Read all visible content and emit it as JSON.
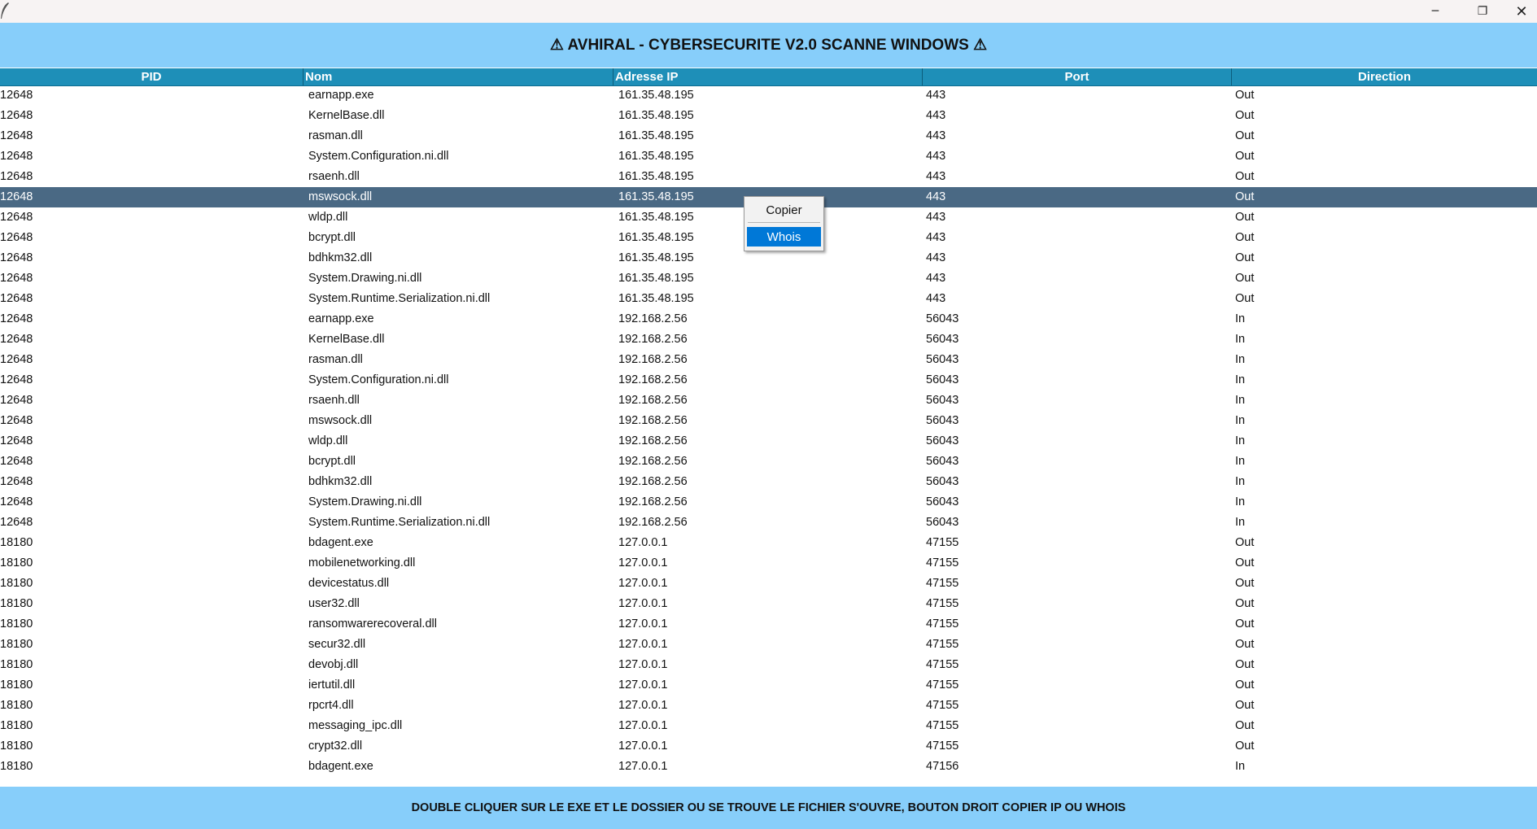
{
  "window": {
    "app_icon": "feather-icon",
    "controls": {
      "minimize": "─",
      "maximize": "❐",
      "close": "✕"
    }
  },
  "header": {
    "title": "⚠ AVHIRAL - CYBERSECURITE V2.0 SCANNE WINDOWS ⚠"
  },
  "table": {
    "columns": [
      "PID",
      "Nom",
      "Adresse IP",
      "Port",
      "Direction"
    ],
    "selected_row_index": 5,
    "rows": [
      [
        "12648",
        "earnapp.exe",
        "161.35.48.195",
        "443",
        "Out"
      ],
      [
        "12648",
        "KernelBase.dll",
        "161.35.48.195",
        "443",
        "Out"
      ],
      [
        "12648",
        "rasman.dll",
        "161.35.48.195",
        "443",
        "Out"
      ],
      [
        "12648",
        "System.Configuration.ni.dll",
        "161.35.48.195",
        "443",
        "Out"
      ],
      [
        "12648",
        "rsaenh.dll",
        "161.35.48.195",
        "443",
        "Out"
      ],
      [
        "12648",
        "mswsock.dll",
        "161.35.48.195",
        "443",
        "Out"
      ],
      [
        "12648",
        "wldp.dll",
        "161.35.48.195",
        "443",
        "Out"
      ],
      [
        "12648",
        "bcrypt.dll",
        "161.35.48.195",
        "443",
        "Out"
      ],
      [
        "12648",
        "bdhkm32.dll",
        "161.35.48.195",
        "443",
        "Out"
      ],
      [
        "12648",
        "System.Drawing.ni.dll",
        "161.35.48.195",
        "443",
        "Out"
      ],
      [
        "12648",
        "System.Runtime.Serialization.ni.dll",
        "161.35.48.195",
        "443",
        "Out"
      ],
      [
        "12648",
        "earnapp.exe",
        "192.168.2.56",
        "56043",
        "In"
      ],
      [
        "12648",
        "KernelBase.dll",
        "192.168.2.56",
        "56043",
        "In"
      ],
      [
        "12648",
        "rasman.dll",
        "192.168.2.56",
        "56043",
        "In"
      ],
      [
        "12648",
        "System.Configuration.ni.dll",
        "192.168.2.56",
        "56043",
        "In"
      ],
      [
        "12648",
        "rsaenh.dll",
        "192.168.2.56",
        "56043",
        "In"
      ],
      [
        "12648",
        "mswsock.dll",
        "192.168.2.56",
        "56043",
        "In"
      ],
      [
        "12648",
        "wldp.dll",
        "192.168.2.56",
        "56043",
        "In"
      ],
      [
        "12648",
        "bcrypt.dll",
        "192.168.2.56",
        "56043",
        "In"
      ],
      [
        "12648",
        "bdhkm32.dll",
        "192.168.2.56",
        "56043",
        "In"
      ],
      [
        "12648",
        "System.Drawing.ni.dll",
        "192.168.2.56",
        "56043",
        "In"
      ],
      [
        "12648",
        "System.Runtime.Serialization.ni.dll",
        "192.168.2.56",
        "56043",
        "In"
      ],
      [
        "18180",
        "bdagent.exe",
        "127.0.0.1",
        "47155",
        "Out"
      ],
      [
        "18180",
        "mobilenetworking.dll",
        "127.0.0.1",
        "47155",
        "Out"
      ],
      [
        "18180",
        "devicestatus.dll",
        "127.0.0.1",
        "47155",
        "Out"
      ],
      [
        "18180",
        "user32.dll",
        "127.0.0.1",
        "47155",
        "Out"
      ],
      [
        "18180",
        "ransomwarerecoveral.dll",
        "127.0.0.1",
        "47155",
        "Out"
      ],
      [
        "18180",
        "secur32.dll",
        "127.0.0.1",
        "47155",
        "Out"
      ],
      [
        "18180",
        "devobj.dll",
        "127.0.0.1",
        "47155",
        "Out"
      ],
      [
        "18180",
        "iertutil.dll",
        "127.0.0.1",
        "47155",
        "Out"
      ],
      [
        "18180",
        "rpcrt4.dll",
        "127.0.0.1",
        "47155",
        "Out"
      ],
      [
        "18180",
        "messaging_ipc.dll",
        "127.0.0.1",
        "47155",
        "Out"
      ],
      [
        "18180",
        "crypt32.dll",
        "127.0.0.1",
        "47155",
        "Out"
      ],
      [
        "18180",
        "bdagent.exe",
        "127.0.0.1",
        "47156",
        "In"
      ]
    ]
  },
  "context_menu": {
    "items": [
      {
        "label": "Copier",
        "highlighted": false
      },
      {
        "label": "Whois",
        "highlighted": true
      }
    ]
  },
  "footer": {
    "text": "DOUBLE CLIQUER SUR LE EXE ET LE DOSSIER OU SE TROUVE LE FICHIER S'OUVRE, BOUTON DROIT COPIER IP OU WHOIS"
  },
  "colors": {
    "header_bg": "#87cefa",
    "column_header_bg": "#1e8fb8",
    "selected_row_bg": "#4a6984",
    "menu_highlight": "#0078d7"
  }
}
